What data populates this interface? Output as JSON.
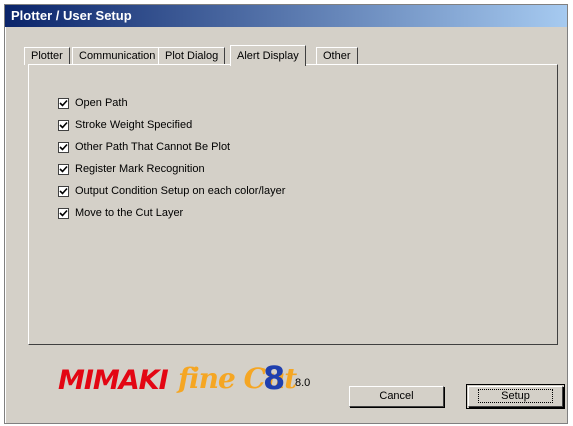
{
  "window": {
    "title": "Plotter / User Setup"
  },
  "tabs": [
    {
      "label": "Plotter",
      "active": false
    },
    {
      "label": "Communication",
      "active": false
    },
    {
      "label": "Plot Dialog",
      "active": false
    },
    {
      "label": "Alert Display",
      "active": true
    },
    {
      "label": "Other",
      "active": false
    }
  ],
  "alerts": [
    {
      "label": "Open Path",
      "checked": true
    },
    {
      "label": "Stroke Weight Specified",
      "checked": true
    },
    {
      "label": "Other Path That Cannot Be Plot",
      "checked": true
    },
    {
      "label": "Register Mark Recognition",
      "checked": true
    },
    {
      "label": "Output Condition Setup on each color/layer",
      "checked": true
    },
    {
      "label": "Move to the Cut Layer",
      "checked": true
    }
  ],
  "branding": {
    "mimaki": "MIMAKI",
    "finecut": "fine Cut",
    "finecut_num": "8",
    "version": "8.0"
  },
  "buttons": {
    "cancel": "Cancel",
    "setup": "Setup"
  },
  "colors": {
    "titlebar_start": "#0a246a",
    "titlebar_end": "#a6caf0",
    "mimaki_red": "#e30613",
    "finecut_orange": "#f5a623",
    "finecut_blue": "#1f3fae"
  }
}
